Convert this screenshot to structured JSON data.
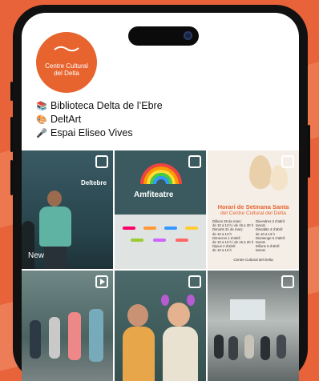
{
  "profile": {
    "logo_line1": "Centre Cultural",
    "logo_line2": "del Delta"
  },
  "links": [
    {
      "icon": "books-icon",
      "text": "Biblioteca Delta de l’Ebre"
    },
    {
      "icon": "palette-icon",
      "text": "DeltArt"
    },
    {
      "icon": "microphone-icon",
      "text": "Espai Eliseo Vives"
    }
  ],
  "posts": {
    "p1_caption": "New",
    "p1_wall": "Deltebre",
    "p2_wall": "Amfiteatre",
    "poster": {
      "title": "Horari de Setmana Santa",
      "subtitle": "del Centre Cultural del Delta",
      "col1": [
        "Dilluns 28 de març:",
        "de 10 a 13 h i de 16 a 20 h",
        "Dimarts 31 de març:",
        "de 10 a 13 h",
        "Dimecres 1 d’abril:",
        "de 10 a 13 h i de 16 a 20 h",
        "Dijous 2 d’abril:",
        "de 10 a 13 h"
      ],
      "col2": [
        "Divendres 3 d’abril:",
        "tancat",
        "Dissabte 4 d’abril:",
        "de 10 a 13 h",
        "Diumenge 5 d’abril:",
        "tancat",
        "Dilluns 6 d’abril:",
        "tancat"
      ],
      "footer": "Centre Cultural del Delta"
    }
  },
  "colors": {
    "brand": "#e7642f"
  }
}
